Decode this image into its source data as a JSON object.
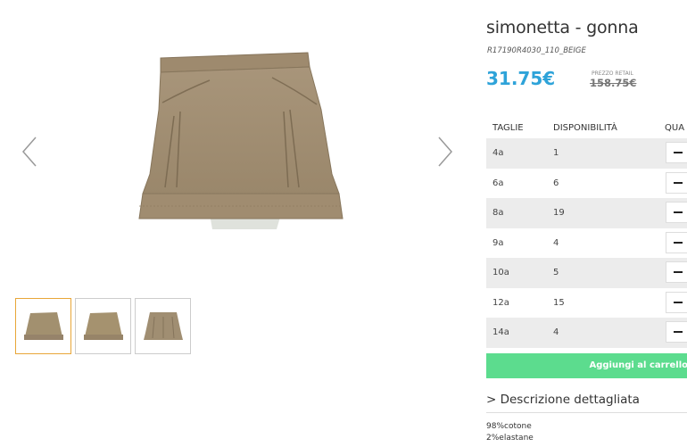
{
  "product": {
    "title": "simonetta - gonna",
    "sku": "R17190R4030_110_BEIGE",
    "price": "31.75€",
    "retail_label": "PREZZO RETAIL",
    "retail_price": "158.75€"
  },
  "table": {
    "headers": {
      "size": "TAGLIE",
      "availability": "DISPONIBILITÀ",
      "quantity": "QUA"
    },
    "rows": [
      {
        "size": "4a",
        "availability": "1"
      },
      {
        "size": "6a",
        "availability": "6"
      },
      {
        "size": "8a",
        "availability": "19"
      },
      {
        "size": "9a",
        "availability": "4"
      },
      {
        "size": "10a",
        "availability": "5"
      },
      {
        "size": "12a",
        "availability": "15"
      },
      {
        "size": "14a",
        "availability": "4"
      }
    ]
  },
  "cart": {
    "label": "Aggiungi al carrello"
  },
  "description": {
    "toggle": "> Descrizione dettagliata",
    "composition": [
      "98%cotone",
      "2%elastane"
    ]
  },
  "colors": {
    "price": "#2ea3d9",
    "cart_button": "#5cdc8e",
    "thumb_active_border": "#e8a638",
    "row_stripe": "#ececec"
  },
  "icons": {
    "prev": "chevron-left-icon",
    "next": "chevron-right-icon",
    "qty": "minus-icon"
  }
}
